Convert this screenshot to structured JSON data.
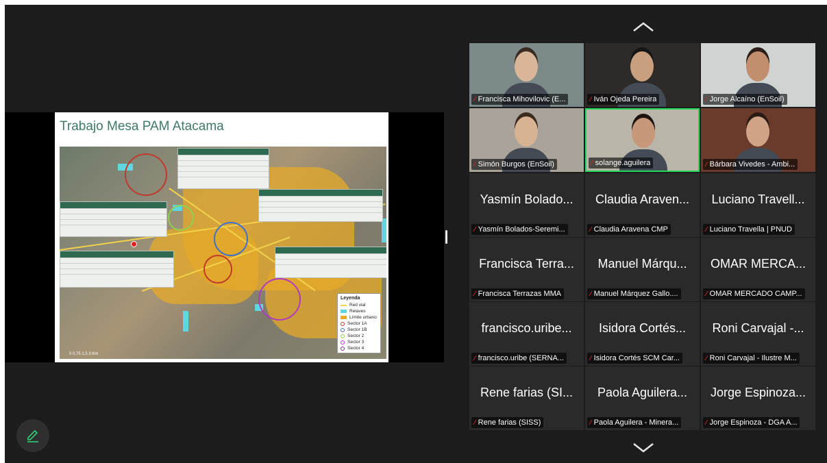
{
  "slide": {
    "title": "Trabajo Mesa PAM Atacama",
    "legend": {
      "title": "Leyenda",
      "items": [
        {
          "label": "Red vial",
          "kind": "line",
          "color": "#f2d24a"
        },
        {
          "label": "Relaves",
          "kind": "fill",
          "color": "#5fd7e0"
        },
        {
          "label": "Límite urbano",
          "kind": "fill",
          "color": "#e9a92a"
        },
        {
          "label": "Sector 1A",
          "kind": "ring",
          "color": "#c0392b"
        },
        {
          "label": "Sector 1B",
          "kind": "ring",
          "color": "#3b6fd1"
        },
        {
          "label": "Sector 2",
          "kind": "ring",
          "color": "#8fd14f"
        },
        {
          "label": "Sector 3",
          "kind": "ring",
          "color": "#b03ac2"
        },
        {
          "label": "Sector 4",
          "kind": "ring",
          "color": "#7a2a8a"
        }
      ]
    },
    "scale": "0   0,75   1,5        3 Km"
  },
  "participants": [
    {
      "tile": "Francisca Mihovilovic (E...",
      "video": true,
      "bg": "#7b8a88",
      "skin": "#d9b59a",
      "hair": "#3a2b22"
    },
    {
      "tile": "Iván Ojeda Pereira",
      "video": true,
      "bg": "#2e2a28",
      "skin": "#c8a080",
      "hair": "#151515"
    },
    {
      "tile": "Jorge Alcaíno (EnSoil)",
      "video": true,
      "bg": "#cfd3d2",
      "skin": "#c28f6e",
      "hair": "#2a2019"
    },
    {
      "tile": "Simón Burgos (EnSoil)",
      "video": true,
      "bg": "#a9a399",
      "skin": "#d7b394",
      "hair": "#3b2c20"
    },
    {
      "tile": "solange.aguilera",
      "video": true,
      "active": true,
      "bg": "#b9b5a8",
      "skin": "#c7987a",
      "hair": "#1d140f"
    },
    {
      "tile": "Bárbara Vivedes - Ambi...",
      "video": true,
      "bg": "#6a3a2a",
      "skin": "#d1a487",
      "hair": "#2a1a14"
    },
    {
      "big": "Yasmín Bolado...",
      "tile": "Yasmín Bolados-Seremi..."
    },
    {
      "big": "Claudia Araven...",
      "tile": "Claudia Aravena CMP"
    },
    {
      "big": "Luciano Travell...",
      "tile": "Luciano Travella | PNUD"
    },
    {
      "big": "Francisca Terra...",
      "tile": "Francisca Terrazas MMA"
    },
    {
      "big": "Manuel Márqu...",
      "tile": "Manuel Márquez Gallo...."
    },
    {
      "big": "OMAR MERCA...",
      "tile": "OMAR MERCADO CAMP..."
    },
    {
      "big": "francisco.uribe...",
      "tile": "francisco.uribe (SERNA..."
    },
    {
      "big": "Isidora Cortés...",
      "tile": "Isidora Cortés SCM Car..."
    },
    {
      "big": "Roni Carvajal -...",
      "tile": "Roni Carvajal - Ilustre M..."
    },
    {
      "big": "Rene farias (SI...",
      "tile": "Rene farias (SISS)"
    },
    {
      "big": "Paola Aguilera...",
      "tile": "Paola Aguilera - Minera..."
    },
    {
      "big": "Jorge Espinoza...",
      "tile": "Jorge Espinoza - DGA A..."
    }
  ],
  "icons": {
    "scroll_up": "chevron-up-icon",
    "scroll_down": "chevron-down-icon",
    "annotate": "pencil-icon",
    "muted": "mic-muted-icon"
  }
}
